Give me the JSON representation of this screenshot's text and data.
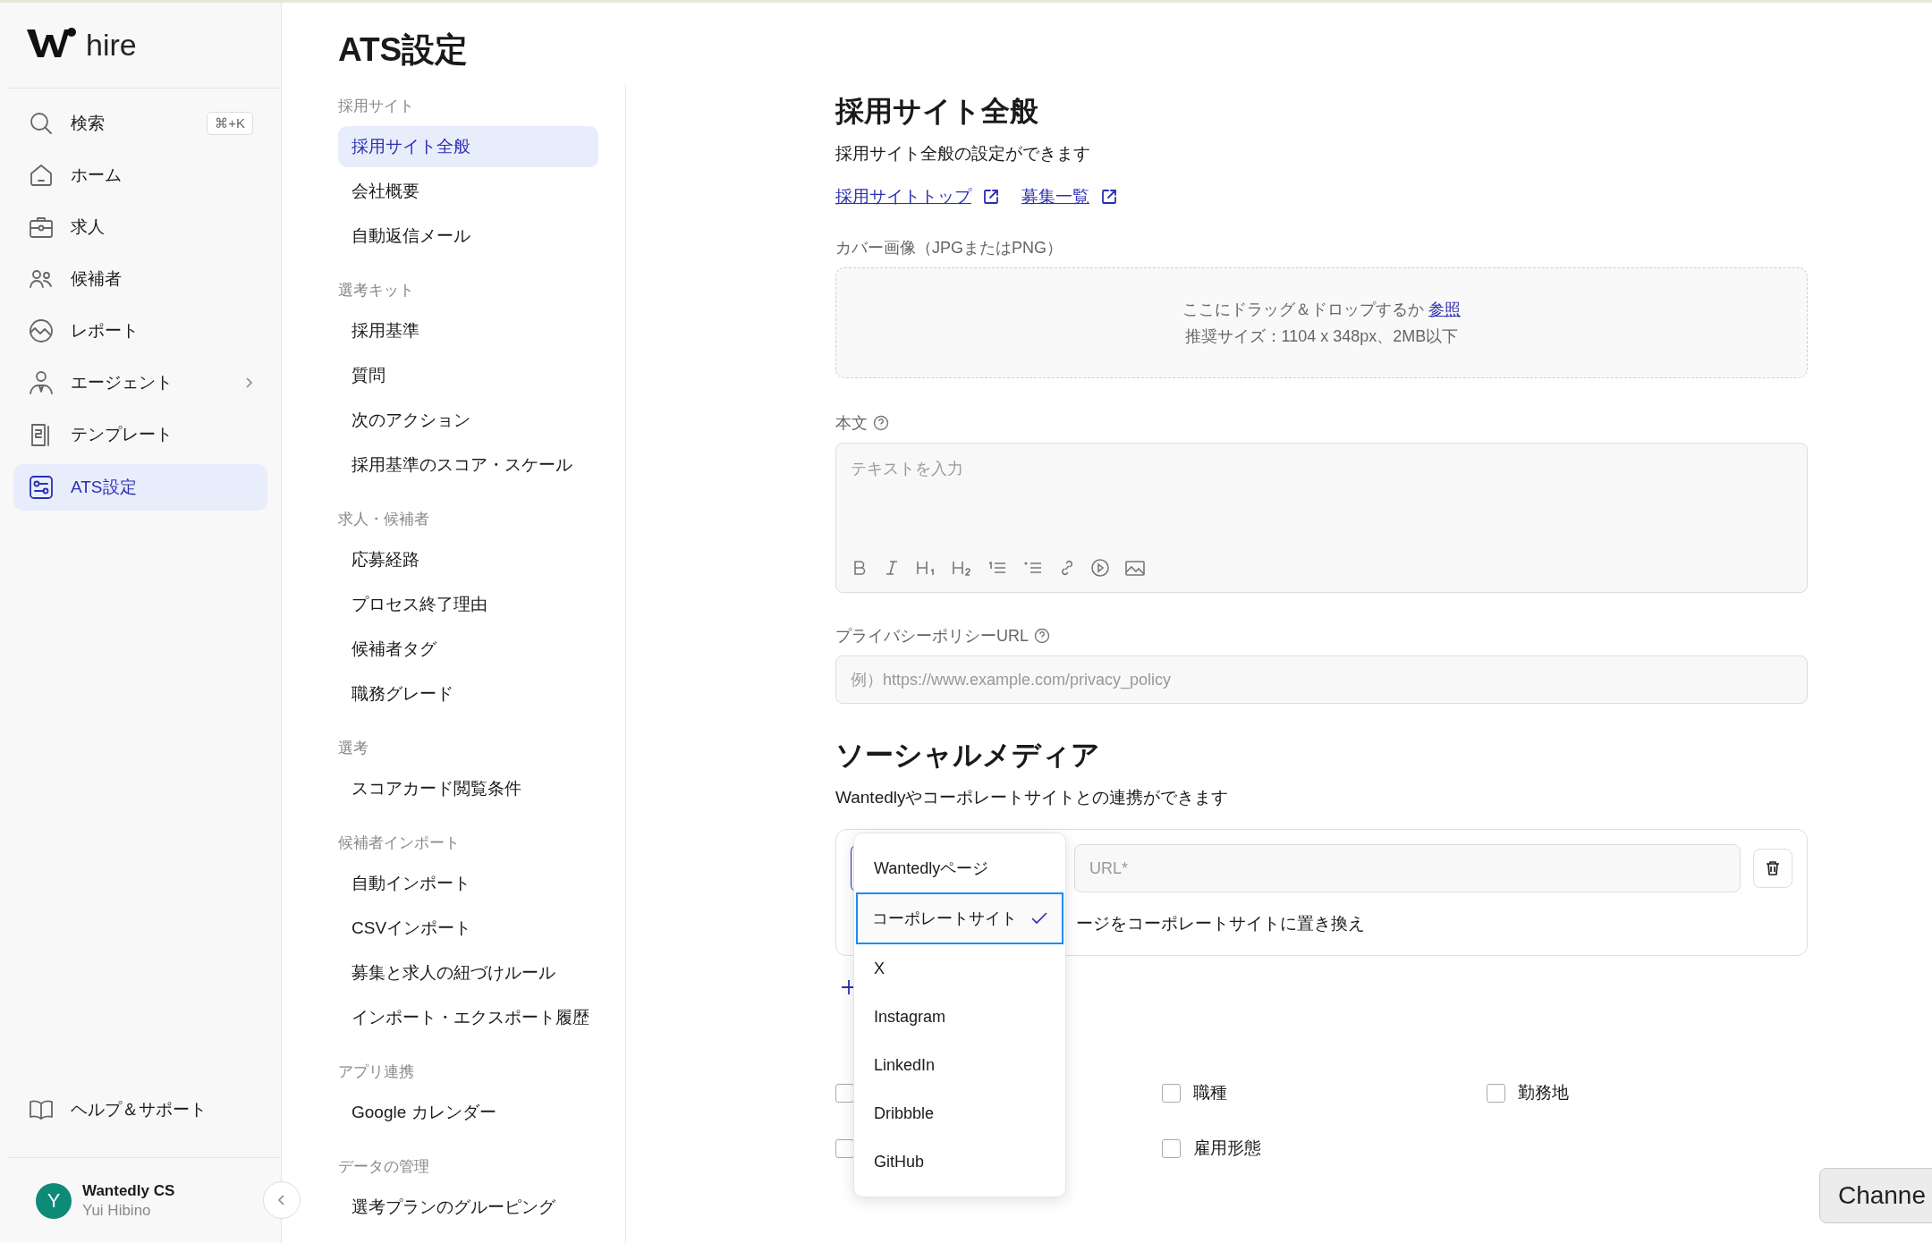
{
  "app": {
    "logo_text": "hire"
  },
  "sidebar": {
    "items": [
      {
        "label": "検索",
        "selected": false,
        "shortcut": "⌘+K"
      },
      {
        "label": "ホーム",
        "selected": false
      },
      {
        "label": "求人",
        "selected": false
      },
      {
        "label": "候補者",
        "selected": false
      },
      {
        "label": "レポート",
        "selected": false
      },
      {
        "label": "エージェント",
        "selected": false,
        "submenu": true
      },
      {
        "label": "テンプレート",
        "selected": false
      },
      {
        "label": "ATS設定",
        "selected": true
      }
    ],
    "help": {
      "label": "ヘルプ＆サポート"
    },
    "user": {
      "initial": "Y",
      "name": "Wantedly CS",
      "subtitle": "Yui Hibino"
    }
  },
  "page": {
    "title": "ATS設定"
  },
  "settings_nav": [
    {
      "label": "採用サイト",
      "items": [
        {
          "label": "採用サイト全般",
          "selected": true
        },
        {
          "label": "会社概要",
          "selected": false
        },
        {
          "label": "自動返信メール",
          "selected": false
        }
      ]
    },
    {
      "label": "選考キット",
      "items": [
        {
          "label": "採用基準",
          "selected": false
        },
        {
          "label": "質問",
          "selected": false
        },
        {
          "label": "次のアクション",
          "selected": false
        },
        {
          "label": "採用基準のスコア・スケール",
          "selected": false
        }
      ]
    },
    {
      "label": "求人・候補者",
      "items": [
        {
          "label": "応募経路",
          "selected": false
        },
        {
          "label": "プロセス終了理由",
          "selected": false
        },
        {
          "label": "候補者タグ",
          "selected": false
        },
        {
          "label": "職務グレード",
          "selected": false
        }
      ]
    },
    {
      "label": "選考",
      "items": [
        {
          "label": "スコアカード閲覧条件",
          "selected": false
        }
      ]
    },
    {
      "label": "候補者インポート",
      "items": [
        {
          "label": "自動インポート",
          "selected": false
        },
        {
          "label": "CSVインポート",
          "selected": false
        },
        {
          "label": "募集と求人の紐づけルール",
          "selected": false
        },
        {
          "label": "インポート・エクスポート履歴",
          "selected": false
        }
      ]
    },
    {
      "label": "アプリ連携",
      "items": [
        {
          "label": "Google カレンダー",
          "selected": false
        }
      ]
    },
    {
      "label": "データの管理",
      "items": [
        {
          "label": "選考プランのグルーピング",
          "selected": false
        }
      ]
    }
  ],
  "general": {
    "title": "採用サイト全般",
    "description": "採用サイト全般の設定ができます",
    "links": [
      "採用サイトトップ",
      "募集一覧"
    ],
    "cover": {
      "label": "カバー画像（JPGまたはPNG）",
      "drop_text": "ここにドラッグ＆ドロップするか",
      "browse_link": "参照",
      "hint": "推奨サイズ：1104 x 348px、2MB以下"
    },
    "body": {
      "label": "本文",
      "placeholder": "テキストを入力"
    },
    "privacy": {
      "label": "プライバシーポリシーURL",
      "placeholder": "例）https://www.example.com/privacy_policy"
    }
  },
  "social": {
    "title": "ソーシャルメディア",
    "description": "Wantedlyやコーポレートサイトとの連携ができます",
    "url_placeholder": "URL*",
    "replace_text": "ージをコーポレートサイトに置き換え",
    "dropdown": [
      {
        "label": "Wantedlyページ",
        "selected": false
      },
      {
        "label": "コーポレートサイト",
        "selected": true
      },
      {
        "label": "X",
        "selected": false
      },
      {
        "label": "Instagram",
        "selected": false
      },
      {
        "label": "LinkedIn",
        "selected": false
      },
      {
        "label": "Dribbble",
        "selected": false
      },
      {
        "label": "GitHub",
        "selected": false
      }
    ]
  },
  "fields_section": {
    "checkboxes": [
      {
        "checked": false
      },
      {
        "label": "職種",
        "checked": false
      },
      {
        "label": "勤務地",
        "checked": false
      },
      {
        "checked": false
      },
      {
        "label": "雇用形態",
        "checked": false
      }
    ]
  },
  "chat_button": {
    "label": "Channe"
  }
}
